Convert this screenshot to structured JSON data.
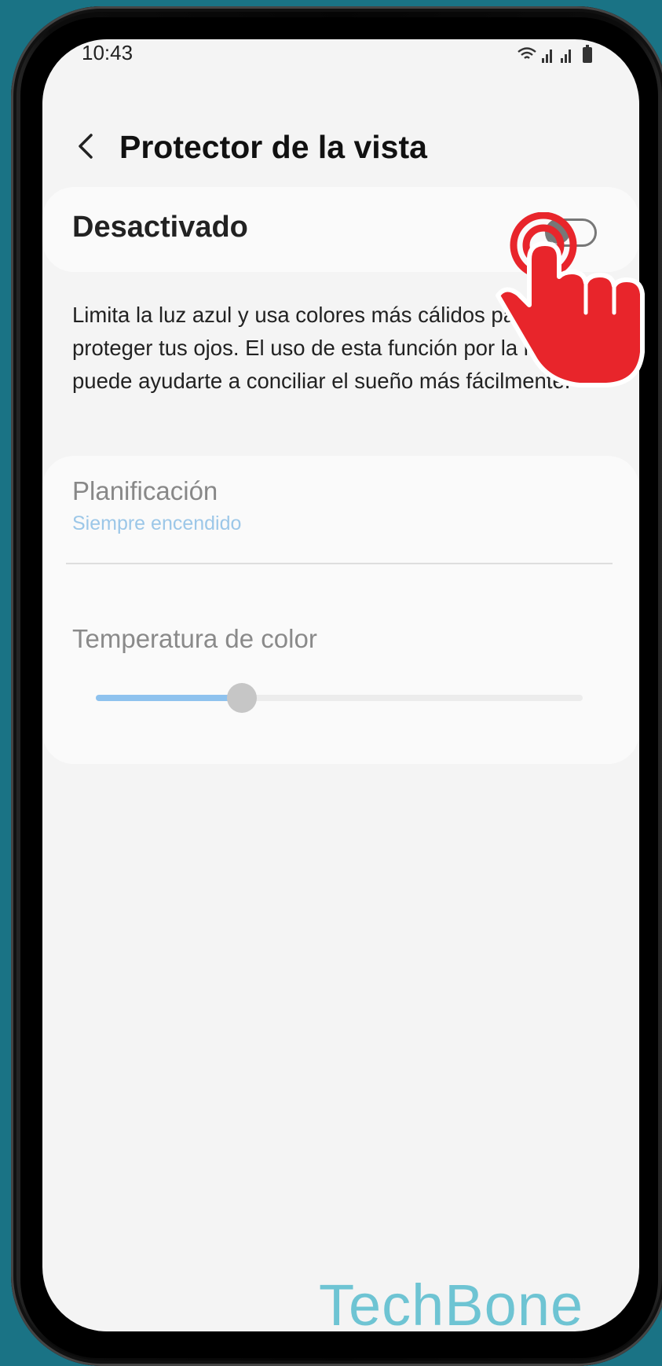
{
  "status_bar": {
    "time": "10:43",
    "icons": [
      "wifi-icon",
      "signal-icon",
      "signal-icon",
      "battery-icon"
    ]
  },
  "header": {
    "back_icon": "chevron-left-icon",
    "title": "Protector de la vista"
  },
  "toggle": {
    "label": "Desactivado",
    "state": "off"
  },
  "description": "Limita la luz azul y usa colores más cálidos para proteger tus ojos. El uso de esta función por la noche puede ayudarte a conciliar el sueño más fácilmente.",
  "settings": {
    "schedule": {
      "title": "Planificación",
      "value": "Siempre encendido"
    },
    "color_temperature": {
      "title": "Temperatura de color",
      "level": 0.3
    }
  },
  "overlay": {
    "pointer_icon": "tap-hand-icon",
    "watermark": "TechBone"
  },
  "colors": {
    "background": "#1a7385",
    "screen": "#f4f4f4",
    "accent_blue": "#9cc7e8",
    "pointer_red": "#e8252b",
    "watermark": "#6ec4d3"
  }
}
